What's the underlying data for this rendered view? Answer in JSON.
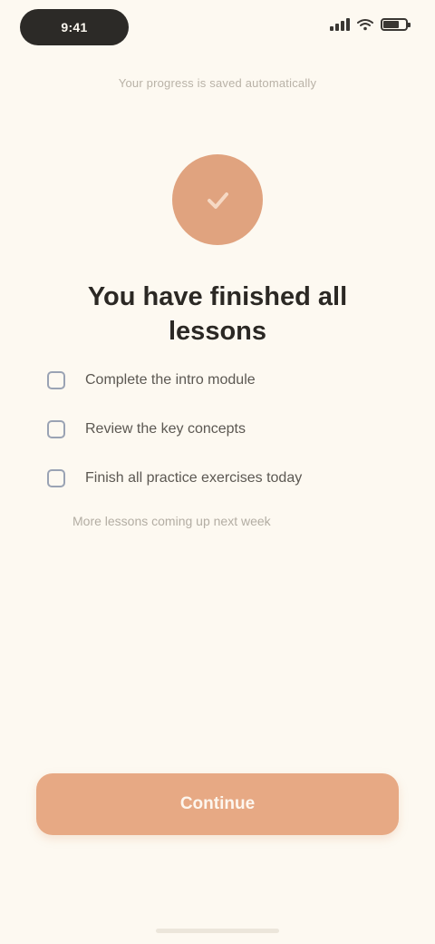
{
  "status_bar": {
    "time": "9:41"
  },
  "notice": "Your progress is saved automatically",
  "title": "You have finished all lessons",
  "checklist": {
    "items": [
      {
        "label": "Complete the intro module"
      },
      {
        "label": "Review the key concepts"
      },
      {
        "label": "Finish all practice exercises today"
      }
    ]
  },
  "footnote": "More lessons coming up next week",
  "cta": {
    "label": "Continue"
  },
  "colors": {
    "background": "#fdf9f1",
    "accent": "#e7a984",
    "hero": "#e0a37f",
    "checkbox_border": "#9aa3b4"
  },
  "icons": {
    "hero": "checkmark-icon",
    "checkbox": "checkbox-icon"
  }
}
